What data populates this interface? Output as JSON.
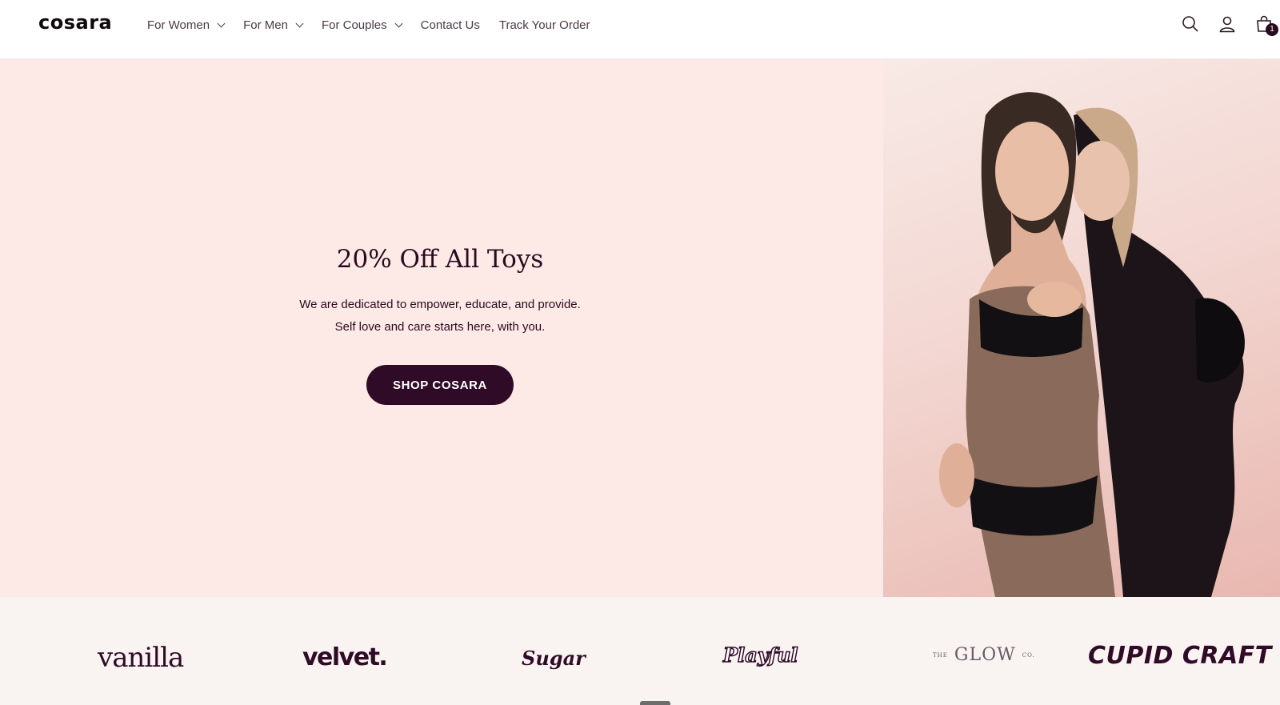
{
  "brand": {
    "logo_text": "cosara"
  },
  "nav": {
    "items": [
      {
        "label": "For Women",
        "has_dropdown": true
      },
      {
        "label": "For Men",
        "has_dropdown": true
      },
      {
        "label": "For Couples",
        "has_dropdown": true
      },
      {
        "label": "Contact Us",
        "has_dropdown": false
      },
      {
        "label": "Track Your Order",
        "has_dropdown": false
      }
    ]
  },
  "header_icons": {
    "search": "search-icon",
    "account": "user-icon",
    "cart": "shopping-bag-icon",
    "cart_count": "1"
  },
  "hero": {
    "title": "20% Off All Toys",
    "description_line1": "We are dedicated to empower, educate, and provide.",
    "description_line2": "Self love and care starts here, with you.",
    "cta_label": "SHOP COSARA",
    "background_color": "#fde9e6",
    "cta_color": "#300b27"
  },
  "brands": {
    "items": [
      {
        "name": "vanilla"
      },
      {
        "name": "velvet."
      },
      {
        "name": "Sugar"
      },
      {
        "name": "Playful"
      },
      {
        "name": "GLOW",
        "prefix": "THE",
        "suffix": "CO."
      },
      {
        "name": "CUPID CRAFT"
      }
    ]
  }
}
